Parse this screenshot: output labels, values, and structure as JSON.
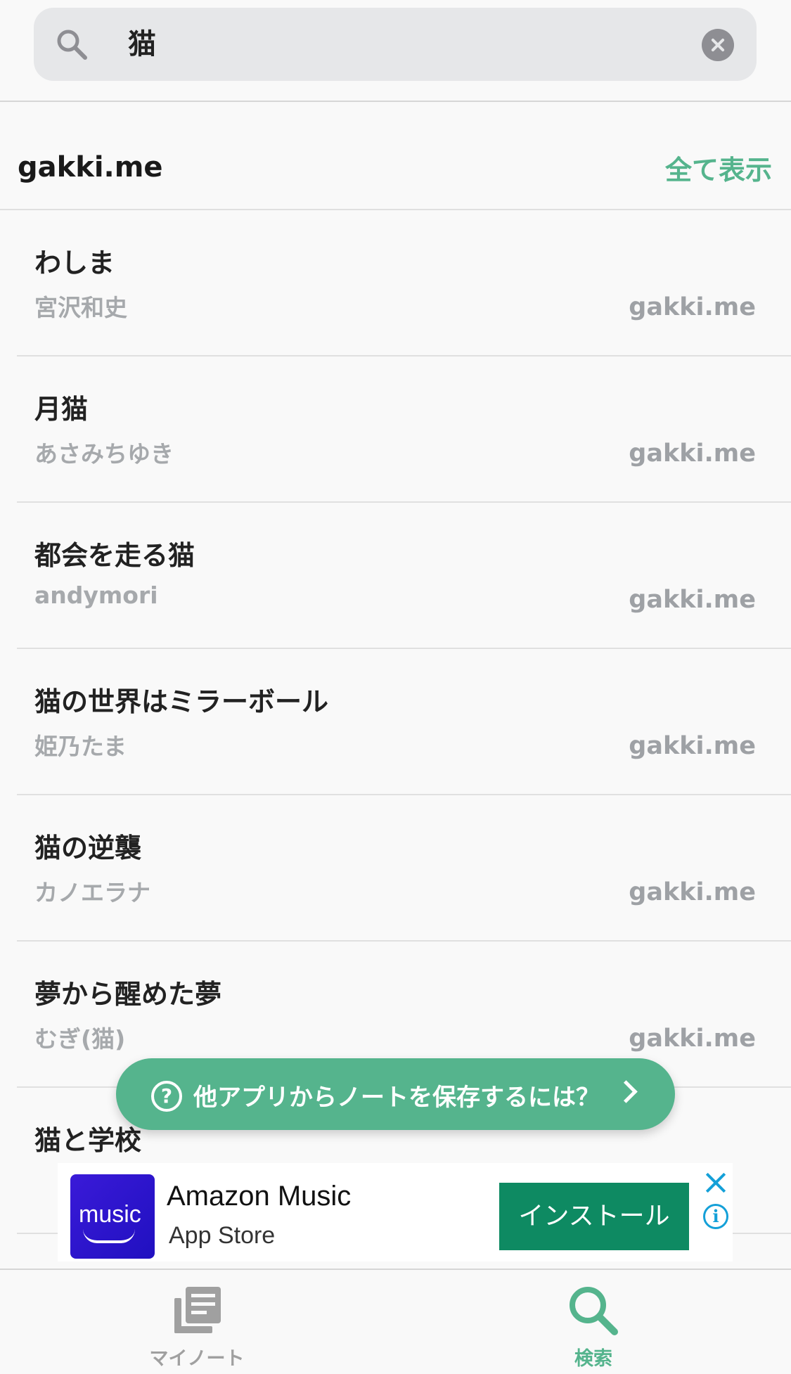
{
  "search": {
    "query": "猫",
    "icon": "search-icon",
    "clear_icon": "clear-icon"
  },
  "section": {
    "title": "gakki.me",
    "show_all_label": "全て表示"
  },
  "results": [
    {
      "title": "わしま",
      "artist": "宮沢和史",
      "source": "gakki.me"
    },
    {
      "title": "月猫",
      "artist": "あさみちゆき",
      "source": "gakki.me"
    },
    {
      "title": "都会を走る猫",
      "artist": "andymori",
      "source": "gakki.me"
    },
    {
      "title": "猫の世界はミラーボール",
      "artist": "姫乃たま",
      "source": "gakki.me"
    },
    {
      "title": "猫の逆襲",
      "artist": "カノエラナ",
      "source": "gakki.me"
    },
    {
      "title": "夢から醒めた夢",
      "artist": "むぎ(猫)",
      "source": "gakki.me"
    },
    {
      "title": "猫と学校",
      "artist": "",
      "source": ""
    }
  ],
  "help_pill": {
    "label": "他アプリからノートを保存するには？",
    "icon": "question-circle-icon"
  },
  "ad": {
    "icon_text": "music",
    "app_name": "Amazon Music",
    "store": "App Store",
    "install_label": "インストール"
  },
  "tabbar": {
    "my_notes_label": "マイノート",
    "search_label": "検索",
    "active_color": "#55b48d",
    "inactive_color": "#a0a0a0"
  },
  "colors": {
    "accent": "#55b48d",
    "install_button": "#0e8a62",
    "ad_icon": "#2e1ee0"
  }
}
